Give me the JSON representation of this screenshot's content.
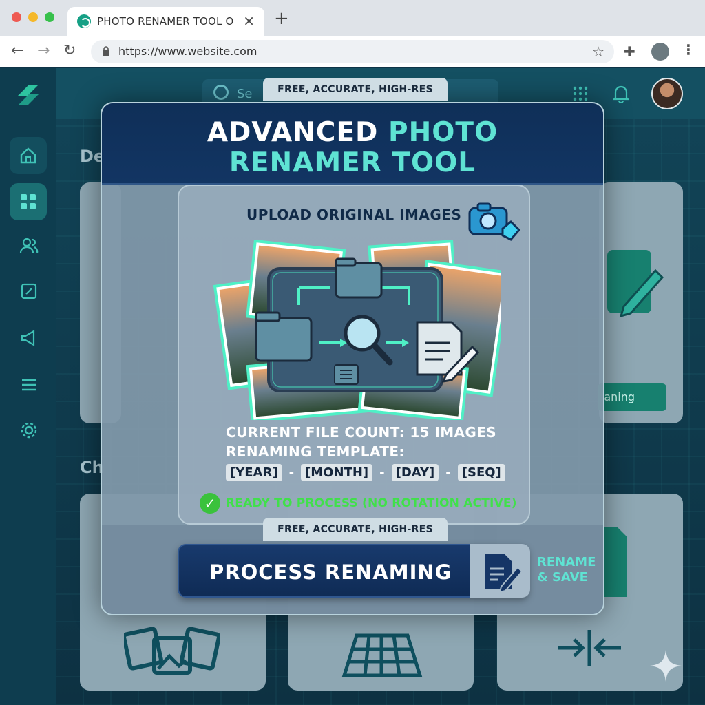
{
  "browser": {
    "tab_title": "PHOTO RENAMER TOOL ON",
    "tab_close": "×",
    "new_tab": "+",
    "url": "https://www.website.com",
    "back": "←",
    "forward": "→",
    "reload": "↻",
    "star": "☆",
    "extensions": "✚",
    "menu": "⋮"
  },
  "dashboard": {
    "search_placeholder": "Se",
    "section_1": "De",
    "section_2": "Ch",
    "card_pill": "aning",
    "sidebar_icons": [
      "home-icon",
      "grid-icon",
      "users-icon",
      "crop-icon",
      "megaphone-icon",
      "list-icon",
      "gear-icon"
    ],
    "header_icons": [
      "apps-icon",
      "bell-icon",
      "avatar"
    ]
  },
  "modal": {
    "ribbon_top": "FREE, ACCURATE, HIGH-RES",
    "title_part1": "ADVANCED ",
    "title_part2": "PHOTO",
    "title_line2": "RENAMER TOOL",
    "upload_label": "UPLOAD ORIGINAL IMAGES",
    "file_count": "CURRENT FILE COUNT: 15 IMAGES",
    "template_label": "RENAMING TEMPLATE:",
    "tokens": [
      "[YEAR]",
      "[MONTH]",
      "[DAY]",
      "[SEQ]"
    ],
    "token_separator": "-",
    "status": "READY TO PROCESS (NO ROTATION ACTIVE)",
    "ribbon_bottom": "FREE, ACCURATE, HIGH-RES",
    "process_button": "PROCESS RENAMING",
    "save_line1": "RENAME",
    "save_line2": "& SAVE"
  },
  "colors": {
    "accent": "#5fe3d3",
    "navy": "#0f2f58",
    "status_green": "#40e04a",
    "sidebar_teal": "#3fc2b6"
  }
}
